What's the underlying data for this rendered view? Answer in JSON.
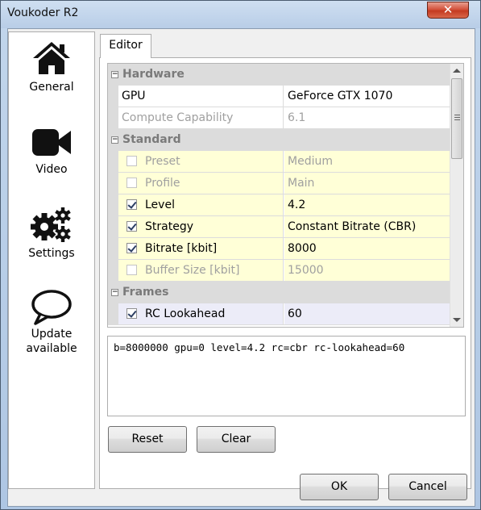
{
  "window": {
    "title": "Voukoder R2",
    "close_label": "✕"
  },
  "sidebar": {
    "items": [
      {
        "label": "General",
        "icon": "home-icon"
      },
      {
        "label": "Video",
        "icon": "video-camera-icon"
      },
      {
        "label": "Settings",
        "icon": "gears-icon"
      },
      {
        "label": "Update\navailable",
        "label_line1": "Update",
        "label_line2": "available",
        "icon": "speech-bubble-icon"
      }
    ]
  },
  "editor": {
    "tab_label": "Editor",
    "categories": [
      {
        "name": "Hardware",
        "rows": [
          {
            "name": "GPU",
            "value": "GeForce GTX 1070"
          },
          {
            "name": "Compute Capability",
            "value": "6.1"
          }
        ]
      },
      {
        "name": "Standard",
        "rows": [
          {
            "name": "Preset",
            "value": "Medium",
            "checked": false
          },
          {
            "name": "Profile",
            "value": "Main",
            "checked": false
          },
          {
            "name": "Level",
            "value": "4.2",
            "checked": true
          },
          {
            "name": "Strategy",
            "value": "Constant Bitrate (CBR)",
            "checked": true
          },
          {
            "name": "Bitrate [kbit]",
            "value": "8000",
            "checked": true
          },
          {
            "name": "Buffer Size [kbit]",
            "value": "15000",
            "checked": false
          }
        ]
      },
      {
        "name": "Frames",
        "rows": [
          {
            "name": "RC Lookahead",
            "value": "60",
            "checked": true
          }
        ]
      }
    ],
    "command_line": "b=8000000 gpu=0 level=4.2 rc=cbr rc-lookahead=60",
    "reset_label": "Reset",
    "clear_label": "Clear"
  },
  "footer": {
    "ok_label": "OK",
    "cancel_label": "Cancel"
  }
}
